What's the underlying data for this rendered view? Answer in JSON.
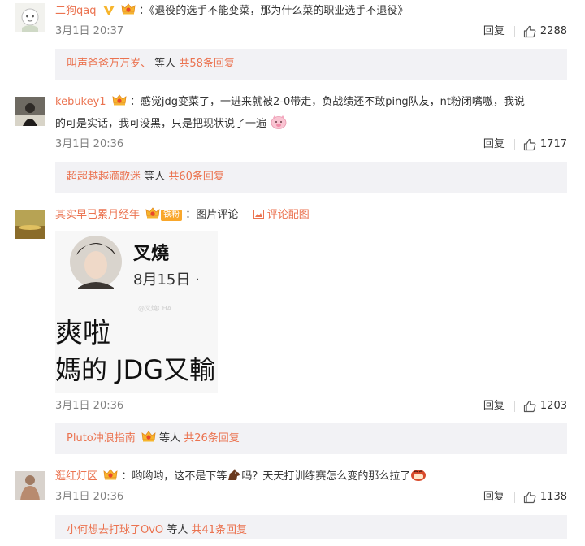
{
  "comments": [
    {
      "user": "二狗qaq",
      "text": "《退役的选手不能变菜，那为什么菜的职业选手不退役》",
      "time": "3月1日 20:37",
      "reply_label": "回复",
      "likes": "2288",
      "sub": {
        "user": "叫声爸爸万万岁、",
        "mid": "等人",
        "count": "共58条回复"
      }
    },
    {
      "user": "kebukey1",
      "text_line1": "感觉jdg变菜了，一进来就被2-0带走，负战绩还不敢ping队友，nt粉闭嘴嗷，我说",
      "text_line2": "的可是实话，我可没黑，只是把现状说了一遍",
      "time": "3月1日 20:36",
      "reply_label": "回复",
      "likes": "1717",
      "sub": {
        "user": "超超越越滴歌迷",
        "mid": "等人",
        "count": "共60条回复"
      }
    },
    {
      "user": "其实早已累月经年",
      "fan_badge": "铁粉",
      "text": "图片评论",
      "image_link": "评论配图",
      "image": {
        "name": "叉燒",
        "date": "8月15日 ·",
        "line1": "爽啦",
        "line2": "媽的 JDG又輸",
        "watermark": "@叉燒CHA"
      },
      "time": "3月1日 20:36",
      "reply_label": "回复",
      "likes": "1203",
      "sub": {
        "user": "Pluto冲浪指南",
        "mid": "等人",
        "count": "共26条回复"
      }
    },
    {
      "user": "逛红灯区",
      "text_a": "哟哟哟，这不是下等",
      "text_b": "吗？天天打训练赛怎么变的那么拉了",
      "time": "3月1日 20:36",
      "reply_label": "回复",
      "likes": "1138",
      "sub": {
        "user": "小何想去打球了OvO",
        "mid": "等人",
        "count": "共41条回复"
      }
    }
  ],
  "colors": {
    "link": "#eb7350",
    "subbox": "#f2f2f5",
    "meta": "#808080"
  }
}
